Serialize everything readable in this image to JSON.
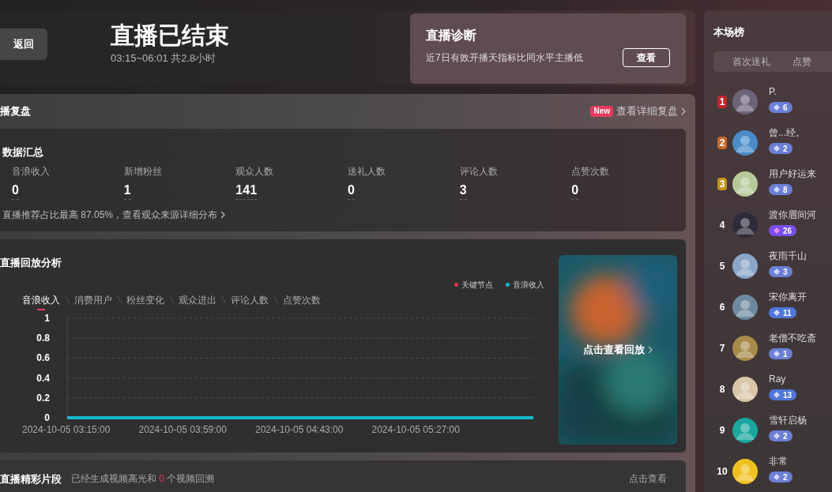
{
  "header": {
    "back_button": "返回",
    "title": "直播已结束",
    "subtitle": "03:15~06:01 共2.8小时"
  },
  "diagnosis": {
    "title": "直播诊断",
    "text": "近7日有效开播天指标比同水平主播低",
    "button": "查看"
  },
  "review": {
    "title": "播复盘",
    "badge": "New",
    "link": "查看详细复盘"
  },
  "summary": {
    "title": "数据汇总",
    "metrics": [
      {
        "label": "音浪收入",
        "value": "0"
      },
      {
        "label": "新增粉丝",
        "value": "1"
      },
      {
        "label": "观众人数",
        "value": "141"
      },
      {
        "label": "送礼人数",
        "value": "0"
      },
      {
        "label": "评论人数",
        "value": "3"
      },
      {
        "label": "点赞次数",
        "value": "0"
      }
    ],
    "note": "直播推荐占比最高 87.05%，查看观众来源详细分布"
  },
  "playback": {
    "title": "直播回放分析",
    "legend": [
      {
        "label": "关键节点",
        "color": "#e8334f"
      }
    ],
    "tabs": [
      {
        "label": "音浪收入",
        "selected": true
      },
      {
        "label": "消费用户",
        "selected": false
      },
      {
        "label": "粉丝变化",
        "selected": false
      },
      {
        "label": "观众进出",
        "selected": false
      },
      {
        "label": "评论人数",
        "selected": false
      },
      {
        "label": "点赞次数",
        "selected": false
      }
    ],
    "chart_data": {
      "type": "line",
      "grid": true,
      "categories": [
        "2024-10-05 03:15:00",
        "2024-10-05 03:59:00",
        "2024-10-05 04:43:00",
        "2024-10-05 05:27:00",
        null
      ],
      "series": [
        {
          "name": "音浪收入",
          "color": "#16b8cf",
          "values": [
            0,
            0,
            0,
            0,
            0
          ]
        }
      ],
      "ylim": [
        0,
        1
      ],
      "yticks": [
        0,
        0.2,
        0.4,
        0.6,
        0.8,
        1
      ]
    },
    "replay": "点击查看回放"
  },
  "highlights": {
    "title": "直播精彩片段",
    "text_before": "已经生成视频高光和",
    "count": "0",
    "text_after": "个视频回溯",
    "link": "点击查看"
  },
  "ranking": {
    "title": "本场榜",
    "tabs": [
      {
        "label": "首次送礼",
        "selected": false
      },
      {
        "label": "点赞",
        "selected": false
      }
    ],
    "users": [
      {
        "rank": "1",
        "color": "#c0262d",
        "name": "P.",
        "gifts": "6",
        "kind": "diamond"
      },
      {
        "rank": "2",
        "color": "#c8692a",
        "name": "曾...经。",
        "gifts": "2",
        "kind": "diamond"
      },
      {
        "rank": "3",
        "color": "#c0961a",
        "name": "用户好运来",
        "gifts": "8",
        "kind": "diamond"
      },
      {
        "rank": "4",
        "name": "渡你眉间河",
        "gifts": "26",
        "kind": "crystal"
      },
      {
        "rank": "5",
        "name": "夜雨千山",
        "gifts": "3",
        "kind": "diamond"
      },
      {
        "rank": "6",
        "name": "宋你离开",
        "gifts": "11",
        "kind": "gem"
      },
      {
        "rank": "7",
        "name": "老僧不吃斋",
        "gifts": "1",
        "kind": "diamond"
      },
      {
        "rank": "8",
        "name": "Ray",
        "gifts": "13",
        "kind": "gem"
      },
      {
        "rank": "9",
        "name": "雪轩启杨",
        "gifts": "2",
        "kind": "diamond"
      },
      {
        "rank": "10",
        "name": "非常",
        "gifts": "2",
        "kind": "diamond"
      }
    ]
  }
}
